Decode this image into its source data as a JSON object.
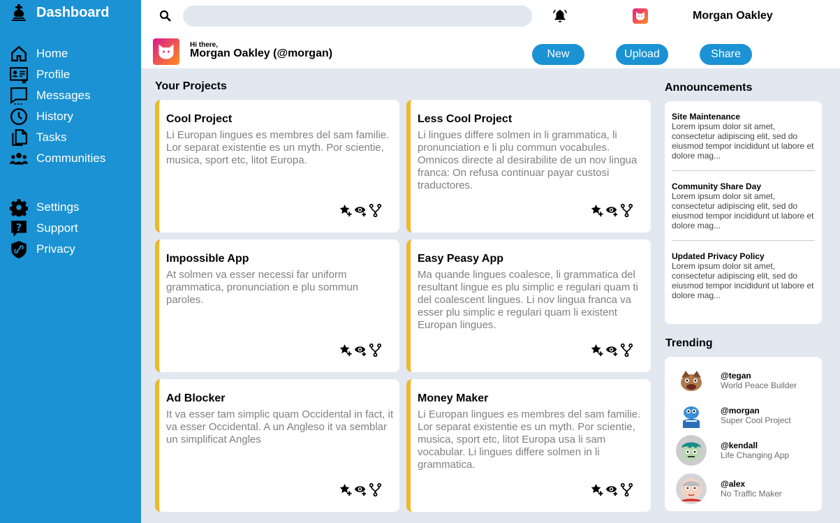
{
  "app": {
    "title": "Dashboard"
  },
  "sidebar": {
    "items": [
      {
        "label": "Home",
        "icon": "home-icon"
      },
      {
        "label": "Profile",
        "icon": "profile-card-icon"
      },
      {
        "label": "Messages",
        "icon": "message-icon"
      },
      {
        "label": "History",
        "icon": "clock-icon"
      },
      {
        "label": "Tasks",
        "icon": "files-icon"
      },
      {
        "label": "Communities",
        "icon": "people-icon"
      },
      {
        "label": "Settings",
        "icon": "gear-icon"
      },
      {
        "label": "Support",
        "icon": "question-icon"
      },
      {
        "label": "Privacy",
        "icon": "shield-link-icon"
      }
    ]
  },
  "header": {
    "search_placeholder": "",
    "user_name": "Morgan Oakley",
    "greeting": "Hi there,",
    "full_name": "Morgan Oakley (@morgan)",
    "buttons": {
      "new": "New",
      "upload": "Upload",
      "share": "Share"
    }
  },
  "projects": {
    "title": "Your Projects",
    "items": [
      {
        "title": "Cool Project",
        "text": "Li Europan lingues es membres del sam familie. Lor separat existentie es un myth. Por scientie, musica, sport etc, litot Europa."
      },
      {
        "title": "Less Cool Project",
        "text": "Li lingues differe solmen in li grammatica, li pronunciation e li plu commun vocabules. Omnicos directe al desirabilite de un nov lingua franca: On refusa continuar payar custosi traductores."
      },
      {
        "title": "Impossible App",
        "text": "At solmen va esser necessi far uniform grammatica, pronunciation e plu sommun paroles."
      },
      {
        "title": "Easy Peasy App",
        "text": "Ma quande lingues coalesce, li grammatica del resultant lingue es plu simplic e regulari quam ti del coalescent lingues. Li nov lingua franca va esser plu simplic e regulari quam li existent Europan lingues."
      },
      {
        "title": "Ad Blocker",
        "text": "It va esser tam simplic quam Occidental in fact, it va esser Occidental. A un Angleso it va semblar un simplificat Angles"
      },
      {
        "title": "Money Maker",
        "text": "Li Europan lingues es membres del sam familie. Lor separat existentie es un myth. Por scientie, musica, sport etc, litot Europa usa li sam vocabular. Li lingues differe solmen in li grammatica."
      }
    ]
  },
  "announcements": {
    "title": "Announcements",
    "items": [
      {
        "title": "Site Maintenance",
        "text": "Lorem ipsum dolor sit amet, consectetur adipiscing elit, sed do eiusmod tempor incididunt ut labore et dolore mag..."
      },
      {
        "title": "Community Share Day",
        "text": "Lorem ipsum dolor sit amet, consectetur adipiscing elit, sed do eiusmod tempor incididunt ut labore et dolore mag..."
      },
      {
        "title": "Updated Privacy Policy",
        "text": "Lorem ipsum dolor sit amet, consectetur adipiscing elit, sed do eiusmod tempor incididunt ut labore et dolore mag..."
      }
    ]
  },
  "trending": {
    "title": "Trending",
    "items": [
      {
        "handle": "@tegan",
        "sub": "World Peace Builder"
      },
      {
        "handle": "@morgan",
        "sub": "Super Cool Project"
      },
      {
        "handle": "@kendall",
        "sub": "Life Changing App"
      },
      {
        "handle": "@alex",
        "sub": "No Traffic Maker"
      }
    ]
  },
  "colors": {
    "accent": "#1b92d3",
    "card_border": "#f0b72b",
    "background": "#e2e8f0"
  }
}
